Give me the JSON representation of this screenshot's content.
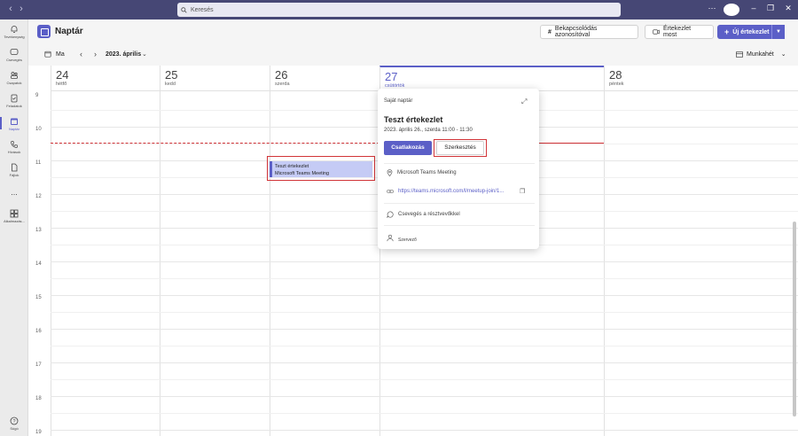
{
  "titlebar": {
    "search_placeholder": "Keresés"
  },
  "rail": {
    "items": [
      {
        "label": "Tevékenység",
        "icon": "bell-icon"
      },
      {
        "label": "Csevegés",
        "icon": "chat-icon"
      },
      {
        "label": "Csapatok",
        "icon": "teams-icon"
      },
      {
        "label": "Feladatok",
        "icon": "tasks-icon"
      },
      {
        "label": "Naptár",
        "icon": "calendar-icon"
      },
      {
        "label": "Hívások",
        "icon": "phone-icon"
      },
      {
        "label": "Fájlok",
        "icon": "file-icon"
      },
      {
        "label": "...",
        "icon": "more-icon"
      },
      {
        "label": "Alkalmazás...",
        "icon": "apps-icon"
      },
      {
        "label": "Súgó",
        "icon": "help-icon"
      }
    ]
  },
  "header": {
    "title": "Naptár",
    "join_with_id": "Bekapcsolódás azonosítóval",
    "meet_now": "Értekezlet most",
    "new_meeting": "Új értekezlet"
  },
  "toolbar": {
    "today": "Ma",
    "current_range": "2023. április",
    "view": "Munkahét"
  },
  "days": [
    {
      "num": "24",
      "name": "hétfő"
    },
    {
      "num": "25",
      "name": "kedd"
    },
    {
      "num": "26",
      "name": "szerda"
    },
    {
      "num": "27",
      "name": "csütörtök"
    },
    {
      "num": "28",
      "name": "péntek"
    }
  ],
  "hours": [
    "9",
    "10",
    "11",
    "12",
    "13",
    "14",
    "15",
    "16",
    "17",
    "18",
    "19"
  ],
  "event": {
    "title": "Teszt értekezlet",
    "location": "Microsoft Teams Meeting"
  },
  "popup": {
    "calendar": "Saját naptár",
    "title": "Teszt értekezlet",
    "time": "2023. április 26., szerda 11:00 - 11:30",
    "join": "Csatlakozás",
    "edit": "Szerkesztés",
    "location": "Microsoft Teams Meeting",
    "link": "https://teams.microsoft.com/l/meetup-join/1...",
    "chat": "Csevegés a résztvevőkkel",
    "organizer": "Szervező"
  },
  "colors": {
    "accent": "#5b5fc7",
    "titlebar": "#464775",
    "highlight_outline": "#d13438",
    "event_fill": "#c5cbf5"
  }
}
